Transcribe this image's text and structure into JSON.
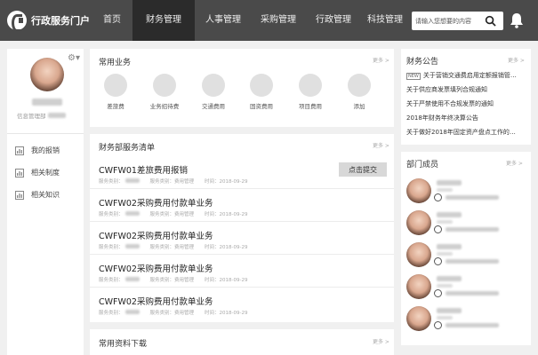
{
  "header": {
    "app_title": "行政服务门户",
    "nav": [
      "首页",
      "财务管理",
      "人事管理",
      "采购管理",
      "行政管理",
      "科技管理"
    ],
    "active_nav": "财务管理",
    "search_placeholder": "请输入您想要的内容"
  },
  "profile": {
    "name": "姜姜婷",
    "dept": "信息管理部"
  },
  "side_links": [
    "我的报销",
    "相关制度",
    "相关知识"
  ],
  "common_business": {
    "title": "常用业务",
    "more": "更多 >",
    "items": [
      "差旅费",
      "业务招待费",
      "交通费用",
      "固资费用",
      "项目费用",
      "添加"
    ]
  },
  "service_list": {
    "title": "财务部服务清单",
    "more": "更多 >",
    "meta_prefix_1": "服务类别：",
    "meta_prefix_2": "服务类别：费用管理",
    "meta_prefix_3": "时间：",
    "submit_label": "点击提交",
    "items": [
      {
        "title": "CWFW01差旅费用报销",
        "date": "2018-09-29"
      },
      {
        "title": "CWFW02采购费用付款单业务",
        "date": "2018-09-29"
      },
      {
        "title": "CWFW02采购费用付款单业务",
        "date": "2018-09-29"
      },
      {
        "title": "CWFW02采购费用付款单业务",
        "date": "2018-09-29"
      },
      {
        "title": "CWFW02采购费用付款单业务",
        "date": "2018-09-29"
      }
    ]
  },
  "downloads": {
    "title": "常用资料下载",
    "more": "更多 >"
  },
  "finance_notices": {
    "title": "财务公告",
    "more": "更多 >",
    "new_badge": "NEW",
    "items": [
      "关于营销交通费启用定额报销管…",
      "关于供应商发票填列合规通知",
      "关于严禁使用不合规发票的通知",
      "2018年财务年终决算公告",
      "关于做好2018年固定资产盘点工作的…"
    ]
  },
  "members": {
    "title": "部门成员",
    "more": "更多 >",
    "count": 5
  },
  "colors": {
    "topbar": "#4a4a4a",
    "active_nav": "#2b2b2b",
    "page_bg": "#f0f0f0"
  }
}
